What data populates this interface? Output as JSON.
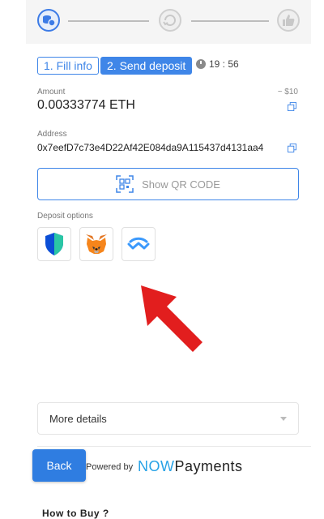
{
  "stepper": {
    "steps": [
      {
        "icon": "coins-icon",
        "state": "active"
      },
      {
        "icon": "refresh-icon",
        "state": "pending"
      },
      {
        "icon": "thumbs-up-icon",
        "state": "pending"
      }
    ]
  },
  "tabs": [
    {
      "label": "1. Fill info"
    },
    {
      "label": "2. Send deposit"
    }
  ],
  "timer": {
    "value": "19 : 56"
  },
  "amount": {
    "label": "Amount",
    "value": "0.00333774 ETH",
    "fiat_estimate": "~ $10"
  },
  "address": {
    "label": "Address",
    "value": "0x7eefD7c73e4D22Af42E084da9A115437d4131aa4"
  },
  "qr": {
    "label": "Show QR CODE"
  },
  "deposit_options": {
    "label": "Deposit options",
    "items": [
      {
        "name": "Trust Wallet",
        "icon": "trust-wallet-icon"
      },
      {
        "name": "MetaMask",
        "icon": "metamask-fox-icon"
      },
      {
        "name": "WalletConnect",
        "icon": "walletconnect-icon"
      }
    ]
  },
  "more_details": {
    "label": "More details"
  },
  "footer": {
    "back_label": "Back",
    "powered_by": "Powered by",
    "brand_now": "NOW",
    "brand_payments": "Payments",
    "how_to_buy": "How to Buy ?"
  },
  "colors": {
    "accent": "#3f86e8",
    "arrow": "#e21e1e",
    "brand": "#27a2e6"
  }
}
